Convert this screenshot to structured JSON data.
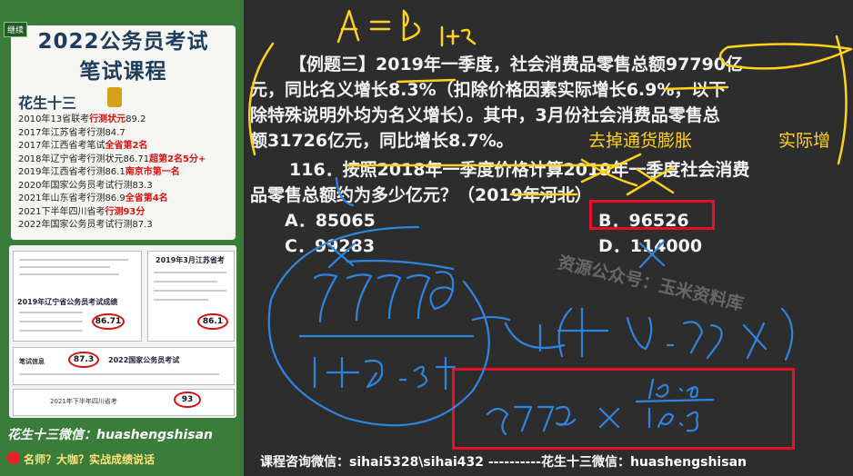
{
  "left_panel": {
    "badge": "继续",
    "title_line1": "2022公务员考试",
    "title_line2": "笔试课程",
    "brand": "花生十三",
    "records": [
      {
        "text": "2010年13省联考",
        "highlight": "行测状元",
        "tail": "89.2"
      },
      {
        "text": "2017年江苏省考行测84.7",
        "highlight": "",
        "tail": ""
      },
      {
        "text": "2017年江西省考笔试",
        "highlight": "全省第2名",
        "tail": ""
      },
      {
        "text": "2018年辽宁省考行测状元86.71",
        "highlight": "超第2名5分+",
        "tail": ""
      },
      {
        "text": "2019年江西省考行测86.1",
        "highlight": "南京市第一名",
        "tail": ""
      },
      {
        "text": "2020年国家公务员考试行测83.3",
        "highlight": "",
        "tail": ""
      },
      {
        "text": "2021年山东省考行测86.9",
        "highlight": "全省第4名",
        "tail": ""
      },
      {
        "text": "2021下半年四川省考",
        "highlight": "行测93分",
        "tail": ""
      },
      {
        "text": "2022年国家公务员考试行测87.3",
        "highlight": "",
        "tail": ""
      }
    ],
    "score_docs": {
      "doc1_title": "2019年辽宁省公务员考试成绩",
      "doc1_score": "86.71",
      "doc2_title": "2019年3月江苏省考",
      "doc2_score": "86.1",
      "doc3_label": "笔试信息",
      "doc3_score": "87.3",
      "doc3_title": "2022国家公务员考试",
      "doc4_row": "2021年下半年四川省考",
      "doc4_score": "93"
    },
    "wechat_line": "花生十三微信：huashengshisan",
    "slogan": "名师？大咖？实战成绩说话"
  },
  "question": {
    "line1": "【例题三】2019年一季度，社会消费品零售总额97790亿",
    "line2": "元，同比名义增长8.3%（扣除价格因素实际增长6.9%，以下",
    "line3": "除特殊说明外均为名义增长）。其中，3月份社会消费品零售总",
    "line4": "额31726亿元，同比增长8.7%。",
    "line5": "116．按照2018年一季度价格计算2019年一季度社会消费",
    "line6": "品零售总额约为多少亿元？（2019年河北）",
    "option_a": "A．85065",
    "option_b": "B．96526",
    "option_c": "C．99283",
    "option_d": "D．114000",
    "annotation_1": "去掉通货膨胀",
    "annotation_2": "实际增"
  },
  "watermark": "资源公众号：玉米资料库",
  "footer": "课程咨询微信：sihai5328\\sihai432 ----------花生十三微信：huashengshisan",
  "colors": {
    "accent_red": "#e5102a",
    "ink_blue": "#2e86e0",
    "ink_yellow": "#ffd21c",
    "panel_green": "#3a7d3b"
  }
}
